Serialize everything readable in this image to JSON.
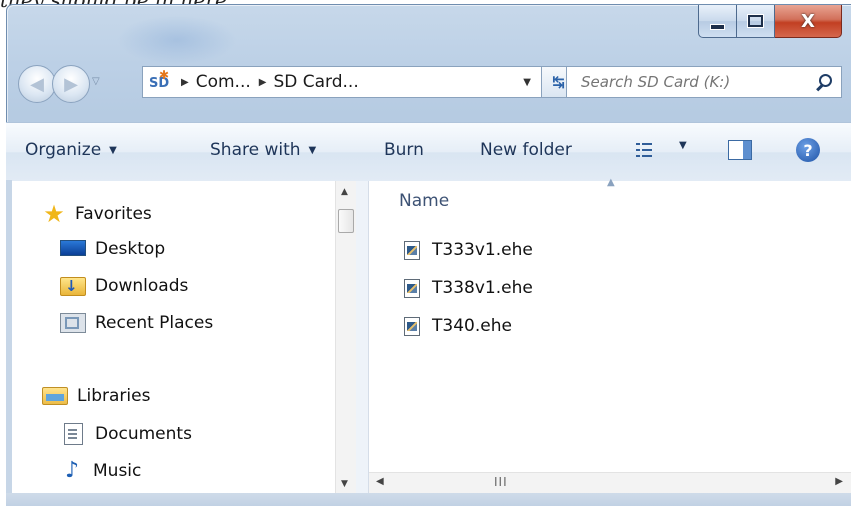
{
  "caption_fragment": "they should be in here.",
  "window": {
    "controls": {
      "minimize": "",
      "maximize": "",
      "close": "X"
    }
  },
  "address_bar": {
    "breadcrumbs": [
      "Com...",
      "SD Card..."
    ],
    "device_label": "SD"
  },
  "search": {
    "placeholder": "Search SD Card (K:)"
  },
  "toolbar": {
    "organize": "Organize",
    "share_with": "Share with",
    "burn": "Burn",
    "new_folder": "New folder"
  },
  "nav_pane": {
    "favorites_label": "Favorites",
    "favorites": [
      "Desktop",
      "Downloads",
      "Recent Places"
    ],
    "libraries_label": "Libraries",
    "libraries": [
      "Documents",
      "Music"
    ]
  },
  "content": {
    "column_header": "Name",
    "files": [
      "T333v1.ehe",
      "T338v1.ehe",
      "T340.ehe"
    ]
  },
  "icons": {
    "favorites": "star-icon",
    "desktop": "desktop-icon",
    "downloads": "downloads-folder-icon",
    "recent": "recent-places-icon",
    "libraries": "libraries-icon",
    "documents": "documents-icon",
    "music": "music-icon",
    "file": "ehe-file-icon"
  },
  "colors": {
    "window_frame": "#bcd0e6",
    "toolbar_text": "#1e3559",
    "close_button": "#c23f22",
    "column_header_text": "#3d5274"
  }
}
